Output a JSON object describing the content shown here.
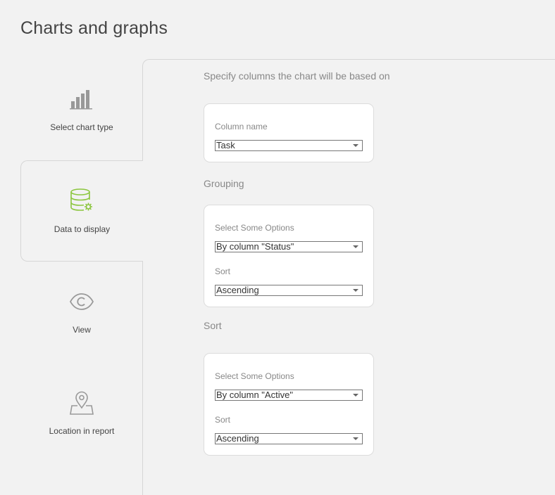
{
  "page": {
    "title": "Charts and graphs"
  },
  "tabs": [
    {
      "label": "Select chart type",
      "icon": "bar-chart-icon"
    },
    {
      "label": "Data to display",
      "icon": "database-settings-icon",
      "active": true
    },
    {
      "label": "View",
      "icon": "eye-icon"
    },
    {
      "label": "Location in report",
      "icon": "location-pin-icon"
    }
  ],
  "main": {
    "columns": {
      "heading": "Specify columns the chart will be based on",
      "column_name_label": "Column name",
      "column_name_value": "Task"
    },
    "grouping": {
      "heading": "Grouping",
      "options_label": "Select Some Options",
      "options_value": "By column \"Status\"",
      "sort_label": "Sort",
      "sort_value": "Ascending"
    },
    "sort": {
      "heading": "Sort",
      "options_label": "Select Some Options",
      "options_value": "By column \"Active\"",
      "sort_label": "Sort",
      "sort_value": "Ascending"
    }
  },
  "colors": {
    "accent": "#8cc63f",
    "icon_gray": "#999999"
  }
}
